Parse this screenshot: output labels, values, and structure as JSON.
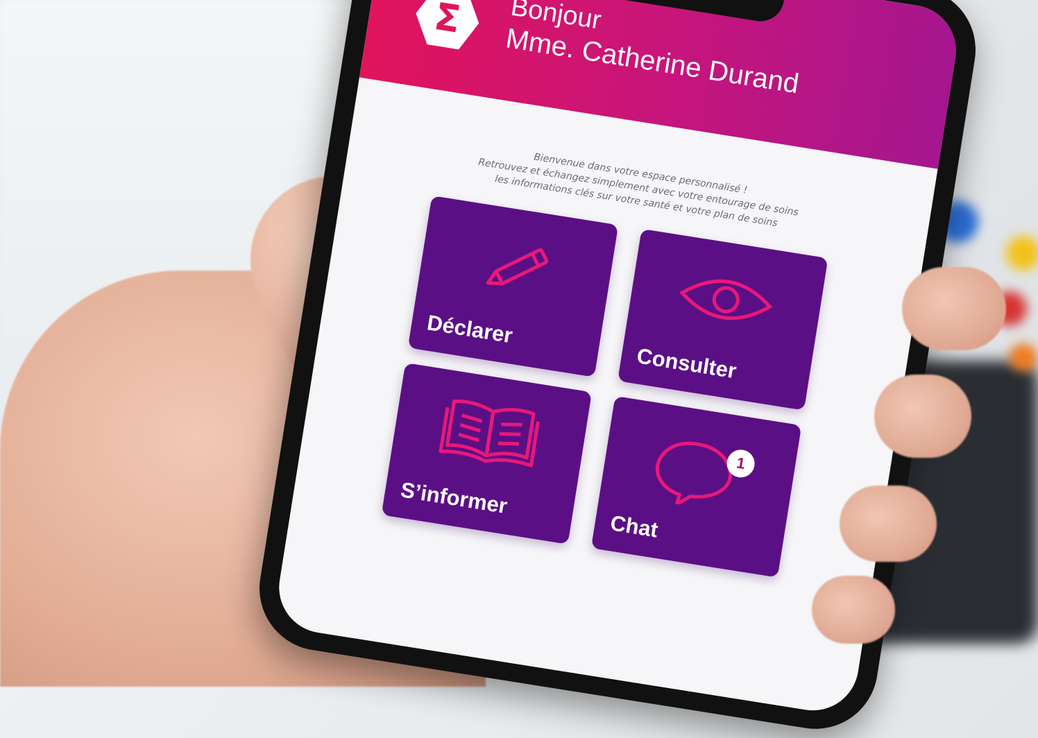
{
  "app": {
    "logo_symbol": "Σ",
    "greeting": "Bonjour",
    "user_name": "Mme. Catherine Durand"
  },
  "welcome": {
    "line1": "Bienvenue dans votre espace personnalisé !",
    "line2": "Retrouvez et échangez simplement avec votre entourage de soins",
    "line3": "les informations clés sur votre santé et votre plan de soins"
  },
  "tiles": [
    {
      "label": "Déclarer",
      "icon": "pencil-icon"
    },
    {
      "label": "Consulter",
      "icon": "eye-icon"
    },
    {
      "label": "S’informer",
      "icon": "book-icon"
    },
    {
      "label": "Chat",
      "icon": "chat-bubble-icon",
      "badge": "1"
    }
  ],
  "colors": {
    "header_start": "#e0145c",
    "header_end": "#a5168f",
    "tile": "#5b0f85",
    "icon": "#e8187a"
  }
}
